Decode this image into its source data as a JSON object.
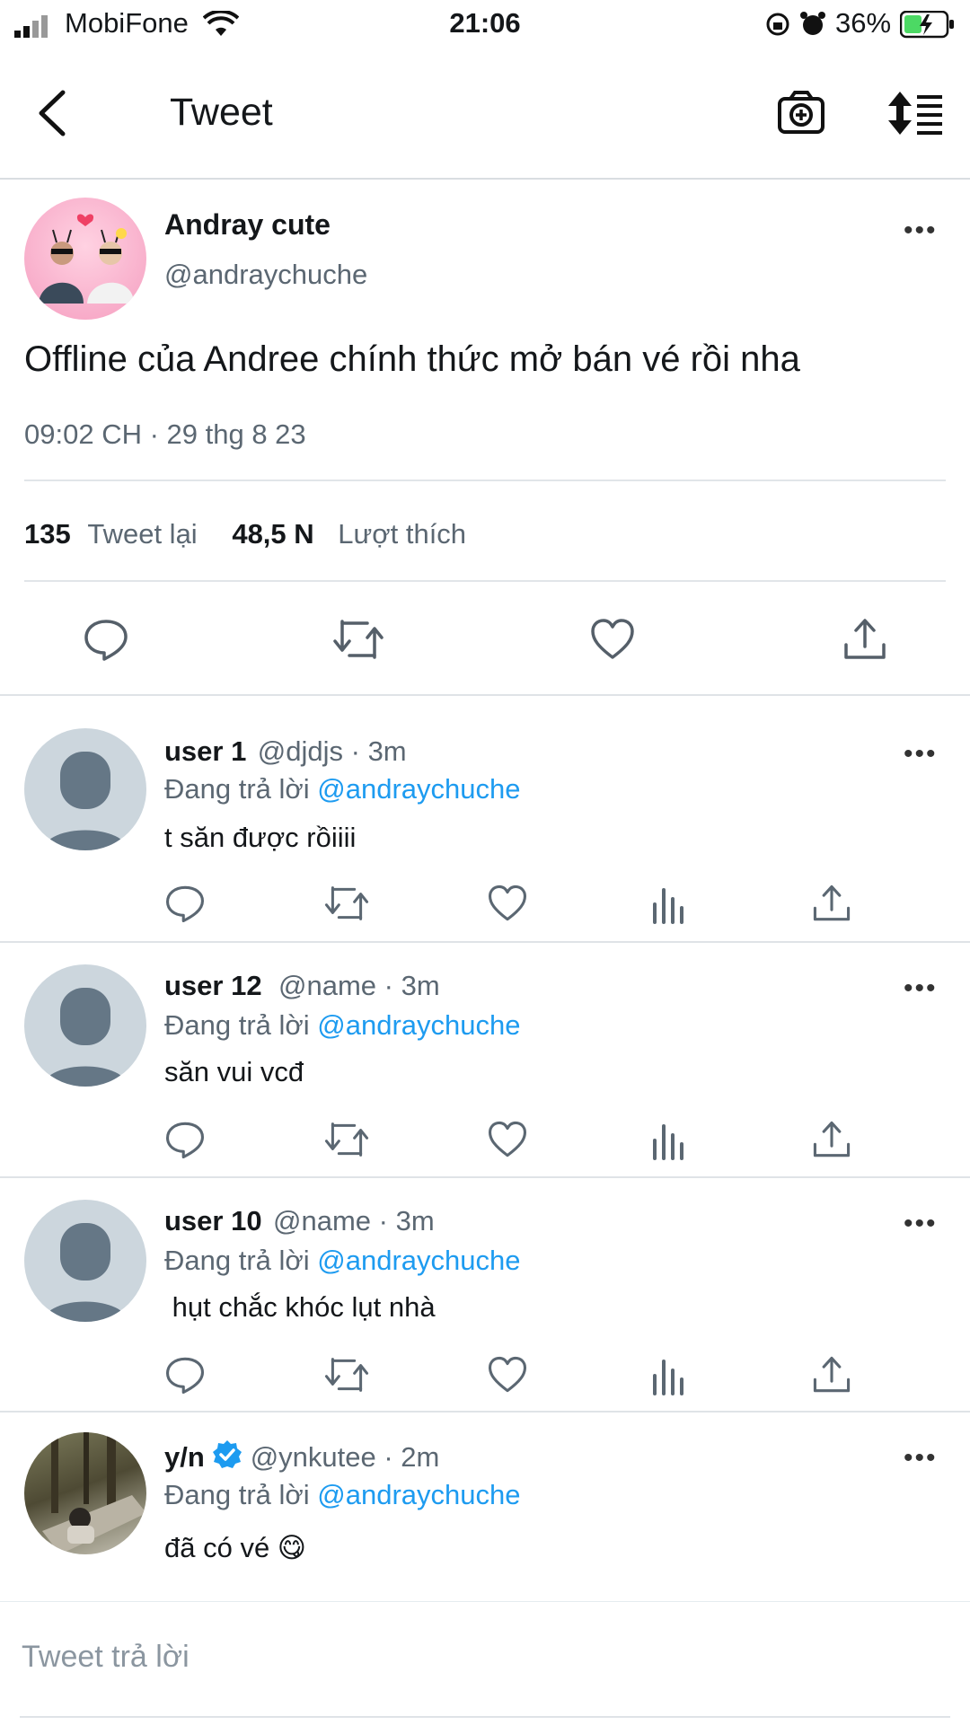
{
  "status_bar": {
    "carrier": "MobiFone",
    "time": "21:06",
    "battery_pct": "36%"
  },
  "nav": {
    "title": "Tweet"
  },
  "tweet": {
    "author_name": "Andray cute",
    "author_handle": "@andraychuche",
    "text": "Offline của Andree chính thức mở bán vé rồi nha",
    "timestamp": "09:02 CH · 29 thg 8 23",
    "retweet_count": "135",
    "retweet_label": "Tweet lại",
    "like_count": "48,5 N",
    "like_label": "Lượt thích"
  },
  "replies": [
    {
      "name": "user 1",
      "meta": "@djdjs · 3m",
      "replying_label": "Đang trả lời",
      "replying_to": "@andraychuche",
      "text": "t săn được rồiiii"
    },
    {
      "name": "user 12",
      "meta": "@name · 3m",
      "replying_label": "Đang trả lời",
      "replying_to": "@andraychuche",
      "text": "săn vui vcđ"
    },
    {
      "name": "user 10",
      "meta": "@name · 3m",
      "replying_label": "Đang trả lời",
      "replying_to": "@andraychuche",
      "text": " hụt chắc khóc lụt nhà"
    },
    {
      "name": "y/n",
      "meta": "@ynkutee · 2m",
      "replying_label": "Đang trả lời",
      "replying_to": "@andraychuche",
      "text": "đã có vé 😋"
    }
  ],
  "composer": {
    "placeholder": "Tweet trả lời"
  },
  "colors": {
    "accent": "#1d9bf0",
    "battery": "#4cd964",
    "secondary_text": "#5b6772"
  }
}
